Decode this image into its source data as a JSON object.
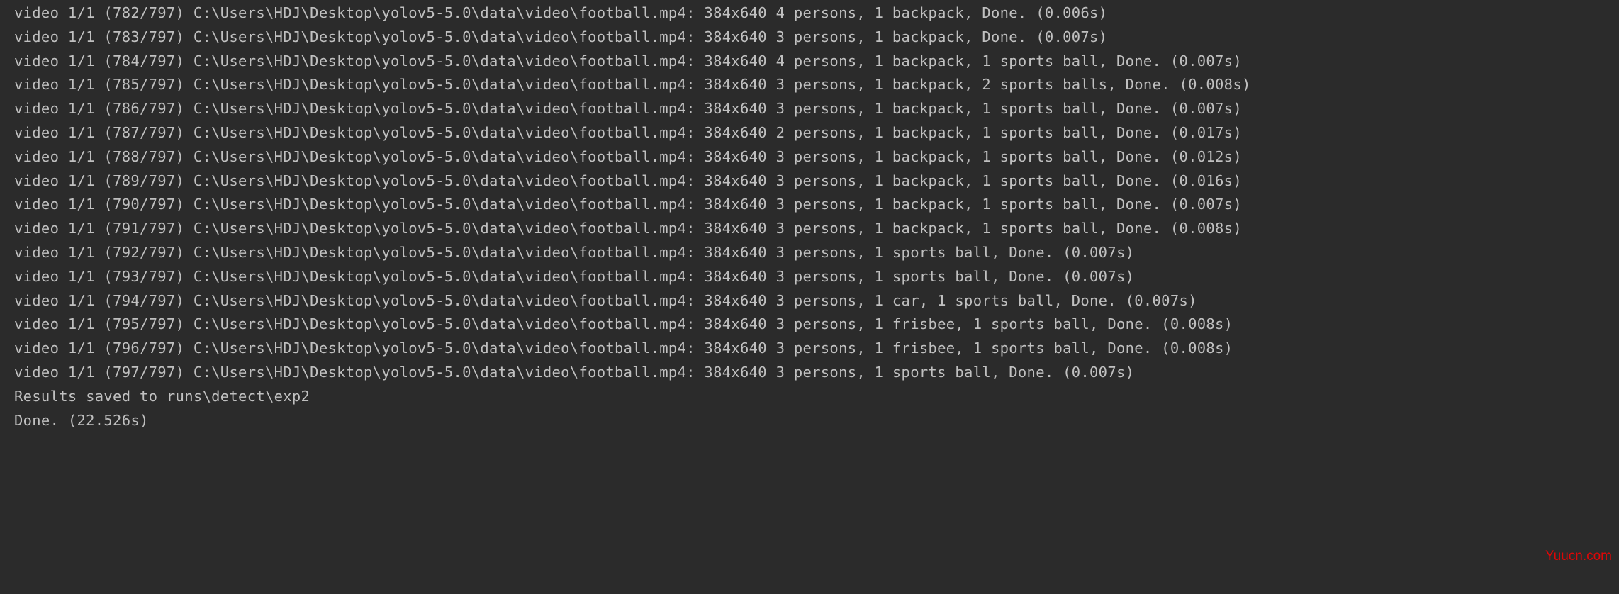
{
  "console": {
    "video_index": "1/1",
    "total_frames": 797,
    "path": "C:\\Users\\HDJ\\Desktop\\yolov5-5.0\\data\\video\\football.mp4",
    "resolution": "384x640",
    "frames": [
      {
        "frame": 782,
        "detections": "4 persons, 1 backpack",
        "time": "0.006s"
      },
      {
        "frame": 783,
        "detections": "3 persons, 1 backpack",
        "time": "0.007s"
      },
      {
        "frame": 784,
        "detections": "4 persons, 1 backpack, 1 sports ball",
        "time": "0.007s"
      },
      {
        "frame": 785,
        "detections": "3 persons, 1 backpack, 2 sports balls",
        "time": "0.008s"
      },
      {
        "frame": 786,
        "detections": "3 persons, 1 backpack, 1 sports ball",
        "time": "0.007s"
      },
      {
        "frame": 787,
        "detections": "2 persons, 1 backpack, 1 sports ball",
        "time": "0.017s"
      },
      {
        "frame": 788,
        "detections": "3 persons, 1 backpack, 1 sports ball",
        "time": "0.012s"
      },
      {
        "frame": 789,
        "detections": "3 persons, 1 backpack, 1 sports ball",
        "time": "0.016s"
      },
      {
        "frame": 790,
        "detections": "3 persons, 1 backpack, 1 sports ball",
        "time": "0.007s"
      },
      {
        "frame": 791,
        "detections": "3 persons, 1 backpack, 1 sports ball",
        "time": "0.008s"
      },
      {
        "frame": 792,
        "detections": "3 persons, 1 sports ball",
        "time": "0.007s"
      },
      {
        "frame": 793,
        "detections": "3 persons, 1 sports ball",
        "time": "0.007s"
      },
      {
        "frame": 794,
        "detections": "3 persons, 1 car, 1 sports ball",
        "time": "0.007s"
      },
      {
        "frame": 795,
        "detections": "3 persons, 1 frisbee, 1 sports ball",
        "time": "0.008s"
      },
      {
        "frame": 796,
        "detections": "3 persons, 1 frisbee, 1 sports ball",
        "time": "0.008s"
      },
      {
        "frame": 797,
        "detections": "3 persons, 1 sports ball",
        "time": "0.007s"
      }
    ],
    "results_saved_label": "Results saved to",
    "results_saved_path": "runs\\detect\\exp2",
    "done_label": "Done.",
    "total_time": "22.526s"
  },
  "watermark": "Yuucn.com"
}
